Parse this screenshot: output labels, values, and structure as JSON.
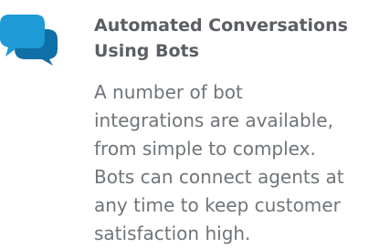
{
  "feature": {
    "icon": "chat-bubbles-icon",
    "title": "Automated Conversations\nUsing Bots",
    "description": "A number of bot\nintegrations are available,\nfrom simple to complex.\nBots can connect agents at\nany time to keep customer\nsatisfaction high."
  },
  "colors": {
    "icon_primary": "#1e9ad6",
    "icon_secondary": "#0f6fa6",
    "title": "#5b5f63",
    "text": "#6f7478"
  }
}
